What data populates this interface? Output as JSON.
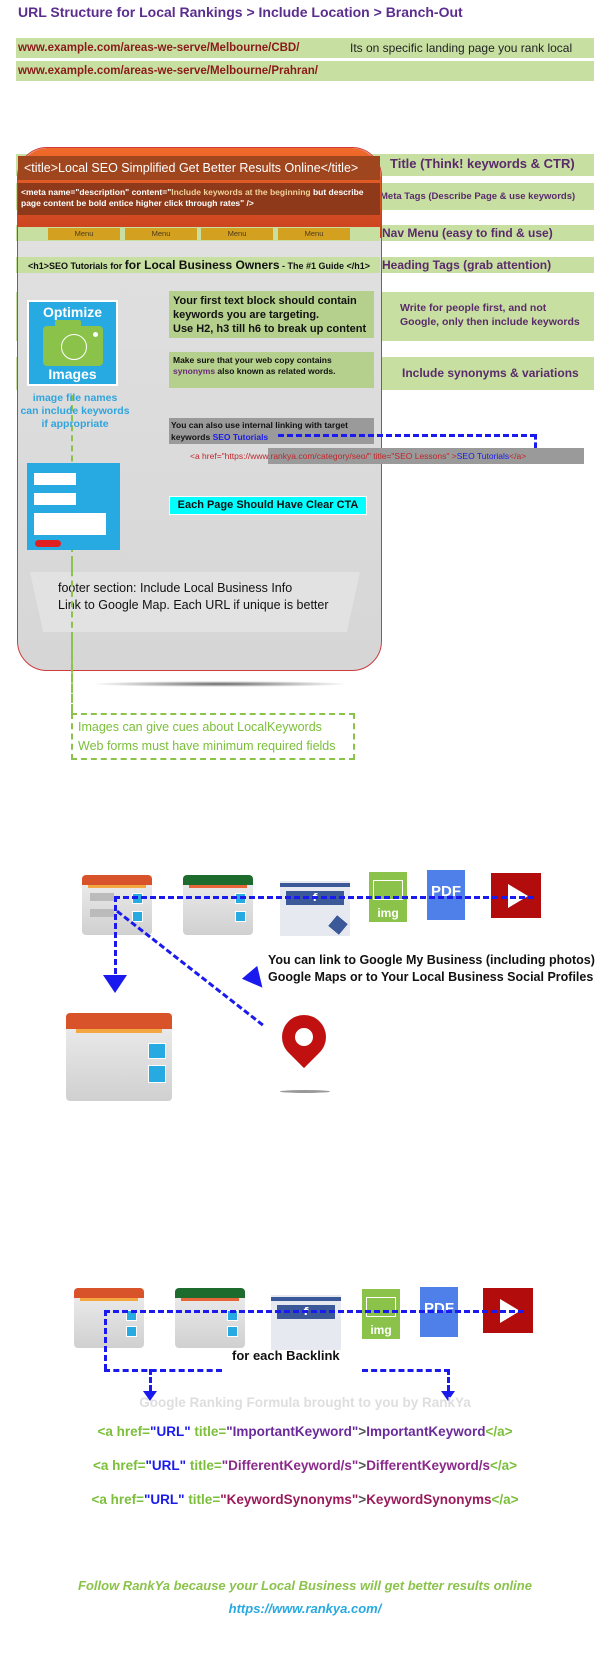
{
  "header": {
    "title": "URL Structure for Local Rankings > Include Location > Branch-Out"
  },
  "url_examples": [
    {
      "url": "www.example.com/areas-we-serve/Melbourne/CBD/",
      "note": "Its on specific landing page you rank local keywords"
    },
    {
      "url": "www.example.com/areas-we-serve/Melbourne/Prahran/",
      "note": ""
    }
  ],
  "page_mockup": {
    "title_tag": "<title>Local SEO Simplified Get Better Results Online</title>",
    "meta_tag": {
      "prefix": "<meta name=\"description\" content=\"",
      "highlight": "Include keywords at the beginning",
      "suffix": " but describe page content be bold entice higher click through rates\" />"
    },
    "menu_items": [
      "Menu",
      "Menu",
      "Menu",
      "Menu"
    ],
    "h1_tag": {
      "prefix": "<h1>SEO Tutorials for ",
      "big": "for Local Business Owners",
      "suffix": " - The #1 Guide </h1>"
    },
    "optimize_images": {
      "top": "Optimize",
      "bottom": "Images"
    },
    "image_note": [
      "image file names",
      "can include keywords",
      "if appropriate"
    ],
    "first_text_block": [
      "Your first text block should contain",
      "keywords you are targeting.",
      "Use H2, h3 till h6 to break up content"
    ],
    "synonyms_block": {
      "line1": "Make sure that your web copy contains",
      "syn_word": "synonyms",
      "line2_rest": " also known as related words."
    },
    "internal_link_block": {
      "line1": "You can also use internal linking with target",
      "line2_prefix": "keywords ",
      "link_text": "SEO Tutorials"
    },
    "href_code": {
      "prefix": "<a href=\"https://www.rankya.com/category/seo/\" title=\"SEO Lessons\" >",
      "link_text": "SEO Tutorials",
      "suffix": "</a>"
    },
    "cta_label": "Each Page Should Have Clear CTA",
    "footer_text": [
      "footer section: Include Local Business Info",
      "Link to Google Map. Each URL if unique is better"
    ]
  },
  "right_labels": {
    "title": "Title (Think! keywords & CTR)",
    "meta": "Meta Tags (Describe Page & use keywords)",
    "nav": "Nav Menu (easy to find & use)",
    "heading": "Heading Tags (grab attention)",
    "write": [
      "Write for people first, and not",
      "Google, only then include keywords"
    ],
    "synonyms": "Include synonyms & variations"
  },
  "green_note": [
    "Images can give cues about LocalKeywords",
    "Web forms must have minimum required fields"
  ],
  "link_section": {
    "icons": [
      "webpage-icon",
      "webpage-green-icon",
      "facebook-page-icon",
      "image-file-icon",
      "pdf-file-icon",
      "youtube-icon"
    ],
    "img_label": "img",
    "pdf_label": "PDF",
    "fb_label": "f",
    "note": [
      "You can link to Google My Business (including photos)",
      "Google Maps or to Your Local Business Social Profiles"
    ]
  },
  "backlink_section": {
    "label": "for each Backlink",
    "formula_title": "Google Ranking Formula brought to you by RankYa",
    "code_lines": [
      {
        "a_open": "<a href=",
        "url": "\"URL\"",
        "title_attr": " title=",
        "keyword": "\"ImportantKeyword\"",
        "gt": ">",
        "text": "ImportantKeyword",
        "close": "</a>"
      },
      {
        "a_open": "<a href=",
        "url": "\"URL\"",
        "title_attr": " title=",
        "keyword": "\"DifferentKeyword/s\"",
        "gt": ">",
        "text": "DifferentKeyword/s",
        "close": "</a>"
      },
      {
        "a_open": "<a href=",
        "url": "\"URL\"",
        "title_attr": " title=",
        "keyword": "\"KeywordSynonyms\"",
        "gt": ">",
        "text": "KeywordSynonyms",
        "close": "</a>"
      }
    ]
  },
  "footer": {
    "follow": "Follow RankYa because your Local Business will get better results online",
    "site": "https://www.rankya.com/"
  },
  "colors": {
    "title_purple": "#5b2d8e",
    "row_green": "#c7e0a2",
    "url_red": "#8b1a1a",
    "arrow_blue": "#1a1aee",
    "dash_green": "#8bc34a",
    "cta_cyan": "#00ffff"
  }
}
